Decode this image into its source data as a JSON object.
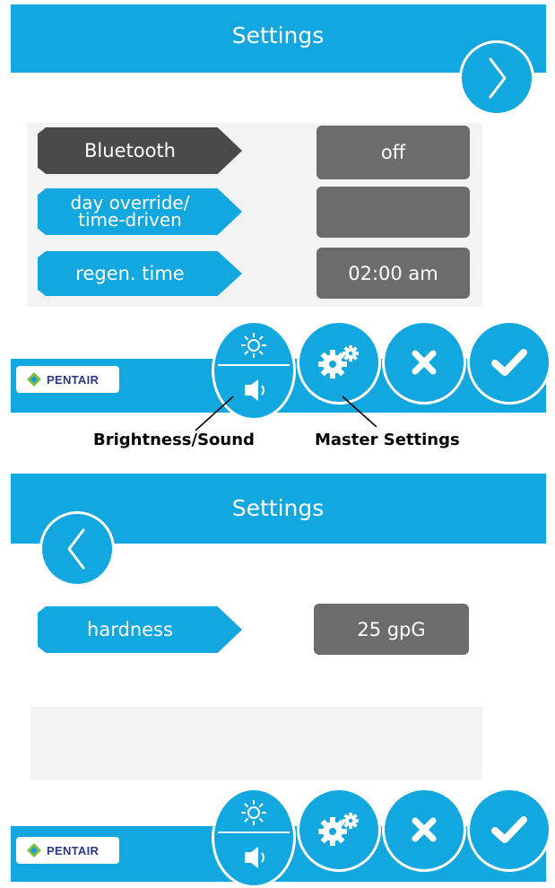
{
  "screen1": {
    "title": "Settings",
    "rows": [
      {
        "label": "Bluetooth",
        "value": "off"
      },
      {
        "label": "day override/\ntime-driven",
        "value": ""
      },
      {
        "label": "regen. time",
        "value": "02:00 am"
      }
    ],
    "brand": "PENTAIR"
  },
  "captions": {
    "brightness": "Brightness/Sound",
    "master": "Master Settings"
  },
  "screen2": {
    "title": "Settings",
    "rows": [
      {
        "label": "hardness",
        "value": "25 gpG"
      }
    ],
    "brand": "PENTAIR"
  },
  "colors": {
    "accent": "#12a8df",
    "dark": "#4a4a4a",
    "value_bg": "#6c6c6c"
  },
  "icons": [
    "chevron-right-icon",
    "chevron-left-icon",
    "sun-icon",
    "speaker-icon",
    "gears-icon",
    "close-icon",
    "check-icon",
    "pentair-logo-icon"
  ]
}
